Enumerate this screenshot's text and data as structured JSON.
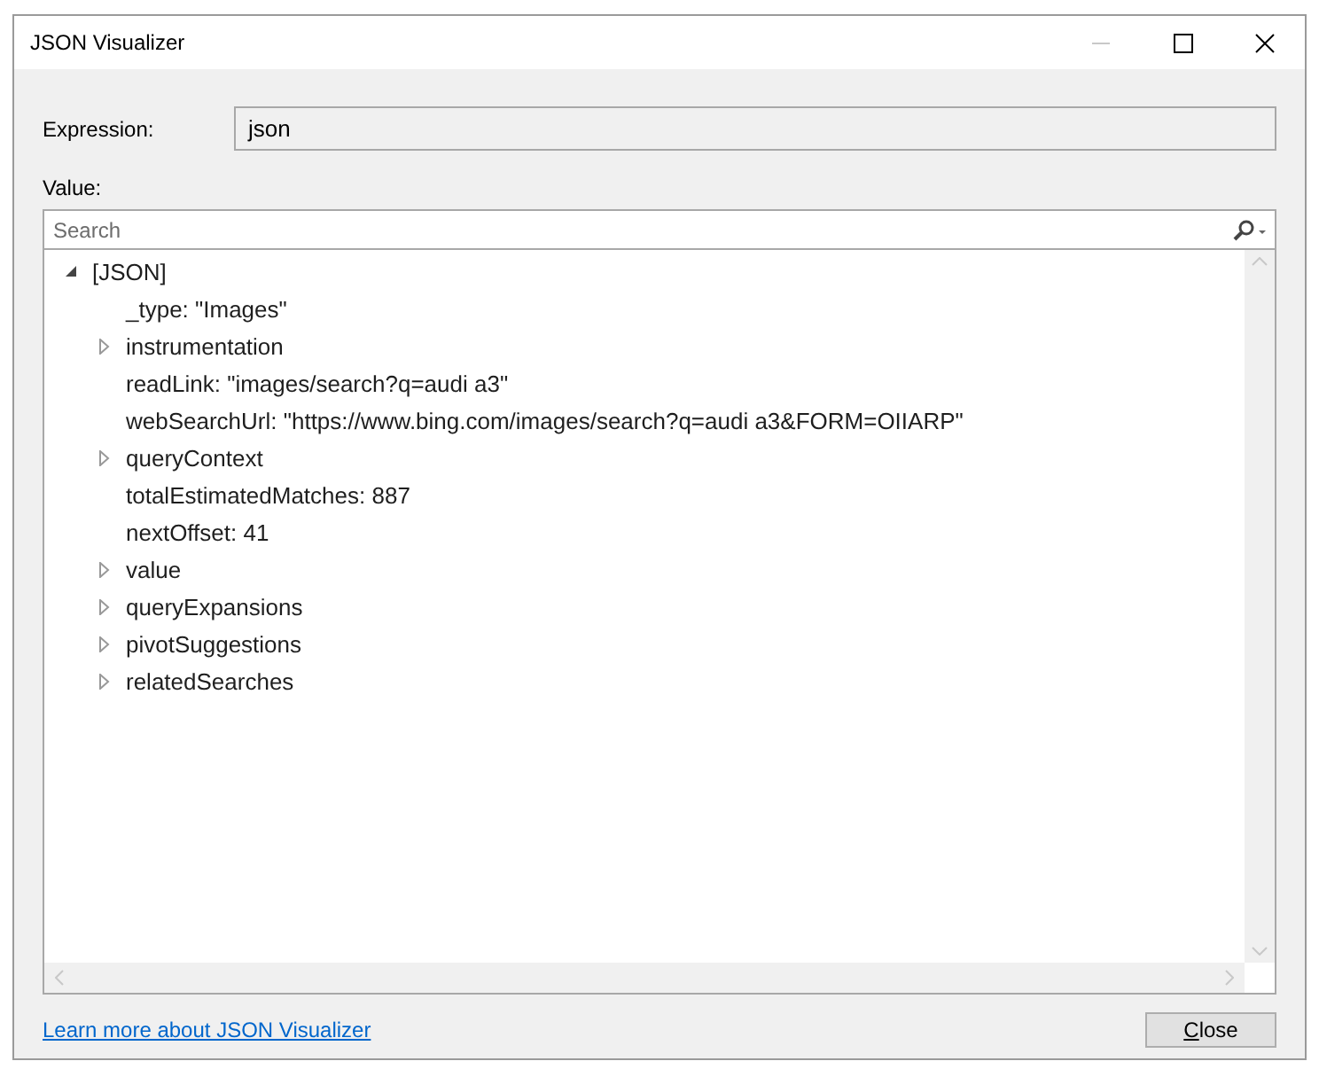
{
  "window": {
    "title": "JSON Visualizer"
  },
  "expression": {
    "label": "Expression:",
    "value": "json"
  },
  "value_label": "Value:",
  "search": {
    "placeholder": "Search"
  },
  "tree": [
    {
      "label": "[JSON]",
      "kind": "object",
      "expanded": true,
      "children": [
        {
          "label": "_type: \"Images\"",
          "kind": "value"
        },
        {
          "label": "instrumentation",
          "kind": "object",
          "expanded": false
        },
        {
          "label": "readLink: \"images/search?q=audi a3\"",
          "kind": "value"
        },
        {
          "label": "webSearchUrl: \"https://www.bing.com/images/search?q=audi a3&FORM=OIIARP\"",
          "kind": "value"
        },
        {
          "label": "queryContext",
          "kind": "object",
          "expanded": false
        },
        {
          "label": "totalEstimatedMatches: 887",
          "kind": "value"
        },
        {
          "label": "nextOffset: 41",
          "kind": "value"
        },
        {
          "label": "value",
          "kind": "object",
          "expanded": false
        },
        {
          "label": "queryExpansions",
          "kind": "object",
          "expanded": false
        },
        {
          "label": "pivotSuggestions",
          "kind": "object",
          "expanded": false
        },
        {
          "label": "relatedSearches",
          "kind": "object",
          "expanded": false
        }
      ]
    }
  ],
  "footer": {
    "link": "Learn more about JSON Visualizer",
    "button": "Close"
  }
}
